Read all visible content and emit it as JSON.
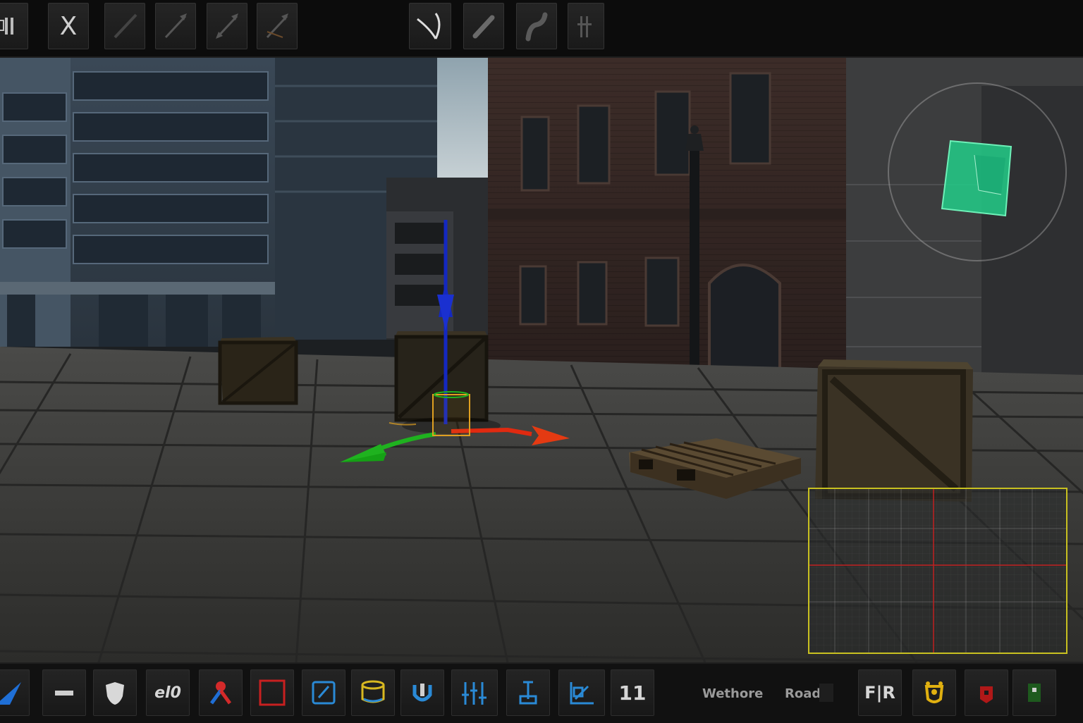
{
  "top_toolbar": {
    "tools": [
      {
        "name": "menu-tool"
      },
      {
        "name": "close-tool",
        "glyph": "X"
      },
      {
        "name": "line-tool"
      },
      {
        "name": "arrow-tool"
      },
      {
        "name": "double-arrow-tool"
      },
      {
        "name": "angled-arrow-tool"
      },
      {
        "name": "curve-tool"
      },
      {
        "name": "bone-tool"
      },
      {
        "name": "bend-tool"
      },
      {
        "name": "grid-tool"
      }
    ]
  },
  "bottom_toolbar": {
    "tools": [
      {
        "name": "select-triangle-tool"
      },
      {
        "name": "minus-tool"
      },
      {
        "name": "shield-tool"
      },
      {
        "name": "counter-tool",
        "text": "el0"
      },
      {
        "name": "pin-tool"
      },
      {
        "name": "rectangle-tool"
      },
      {
        "name": "edit-tool"
      },
      {
        "name": "cylinder-tool"
      },
      {
        "name": "magnet-tool"
      },
      {
        "name": "sliders-tool"
      },
      {
        "name": "stand-tool"
      },
      {
        "name": "chart-tool"
      },
      {
        "name": "layer-count-tool",
        "text": "11"
      }
    ],
    "status_left": "Wethore",
    "status_right": "Road",
    "right_buttons": [
      {
        "name": "fr-toggle",
        "text": "F|R"
      },
      {
        "name": "badge-tool"
      },
      {
        "name": "red-tag-tool"
      },
      {
        "name": "green-tag-tool"
      }
    ]
  },
  "gizmo": {
    "axis_x_color": "#e02a10",
    "axis_y_color": "#1fb21f",
    "axis_z_color": "#1428c0",
    "selection_color": "#e0a020"
  },
  "minimap": {
    "border_color": "#c8c020",
    "crosshair_color": "#c02020"
  },
  "nav_cube_color": "#22cc88"
}
